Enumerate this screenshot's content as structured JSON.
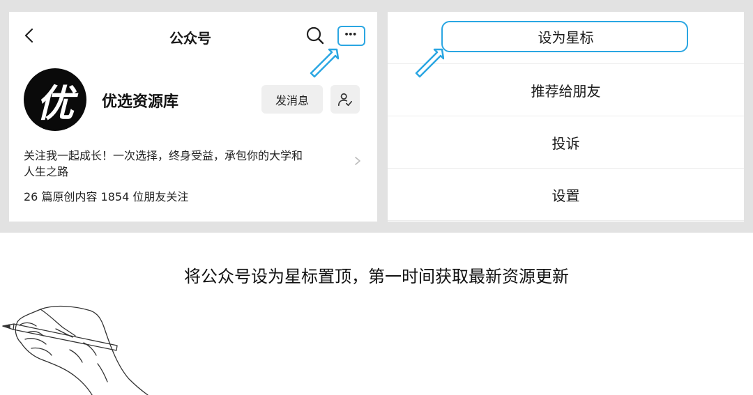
{
  "profile_panel": {
    "nav_title": "公众号",
    "account_name": "优选资源库",
    "avatar_text": "优",
    "message_button": "发消息",
    "bio_line1": "关注我一起成长！一次选择，终身受益，承包你的大学和",
    "bio_line2": "人生之路",
    "stats": "26 篇原创内容  1854 位朋友关注",
    "icons": [
      "back-arrow-icon",
      "search-icon",
      "more-icon",
      "follow-settings-icon",
      "chevron-right-icon"
    ]
  },
  "menu_panel": {
    "items": [
      {
        "label": "设为星标",
        "highlighted": true
      },
      {
        "label": "推荐给朋友"
      },
      {
        "label": "投诉"
      },
      {
        "label": "设置"
      }
    ]
  },
  "caption": "将公众号设为星标置顶，第一时间获取最新资源更新",
  "colors": {
    "highlight": "#2aa6e2",
    "band_background": "#e2e2e2",
    "button_background": "#efefef",
    "avatar_background": "#0a0a0a"
  }
}
